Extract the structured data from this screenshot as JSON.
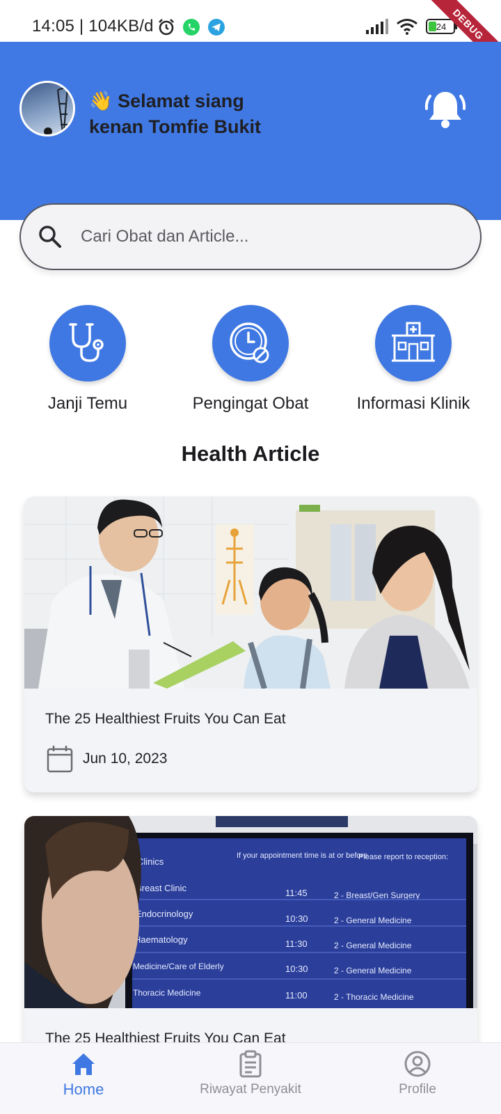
{
  "status_bar": {
    "time": "14:05 | 104KB/d",
    "battery": "24",
    "debug_banner": "DEBUG"
  },
  "header": {
    "greeting_line1": "👋 Selamat siang",
    "greeting_line2": "kenan Tomfie Bukit",
    "bg_color": "#4079e4",
    "notification_icon": "bell-icon"
  },
  "search": {
    "placeholder": "Cari Obat dan Article..."
  },
  "shortcuts": [
    {
      "label": "Janji Temu",
      "icon": "stethoscope-icon"
    },
    {
      "label": "Pengingat Obat",
      "icon": "clock-pill-icon"
    },
    {
      "label": "Informasi Klinik",
      "icon": "hospital-icon"
    }
  ],
  "section": {
    "title": "Health Article"
  },
  "articles": [
    {
      "title": "The 25 Healthiest Fruits You Can Eat",
      "date": "Jun 10, 2023",
      "image": "doctor-child-photo"
    },
    {
      "title": "The 25 Healthiest Fruits You Can Eat",
      "image": "clinic-board-photo"
    }
  ],
  "clinic_board": {
    "headers": [
      "Clinics",
      "If your appointment time is at or before",
      "Please report to reception:"
    ],
    "rows": [
      [
        "Breast Clinic",
        "11:45",
        "2 - Breast/Gen Surgery"
      ],
      [
        "Endocrinology",
        "10:30",
        "2 - General Medicine"
      ],
      [
        "Haematology",
        "11:30",
        "2 - General Medicine"
      ],
      [
        "Medicine/Care of Elderly",
        "10:30",
        "2 - General Medicine"
      ],
      [
        "Thoracic Medicine",
        "11:00",
        "2 - Thoracic Medicine"
      ]
    ]
  },
  "bottom_nav": {
    "items": [
      {
        "label": "Home",
        "icon": "home-icon",
        "active": true
      },
      {
        "label": "Riwayat Penyakit",
        "icon": "clipboard-icon",
        "active": false
      },
      {
        "label": "Profile",
        "icon": "user-circle-icon",
        "active": false
      }
    ],
    "active_color": "#3f78e2"
  }
}
